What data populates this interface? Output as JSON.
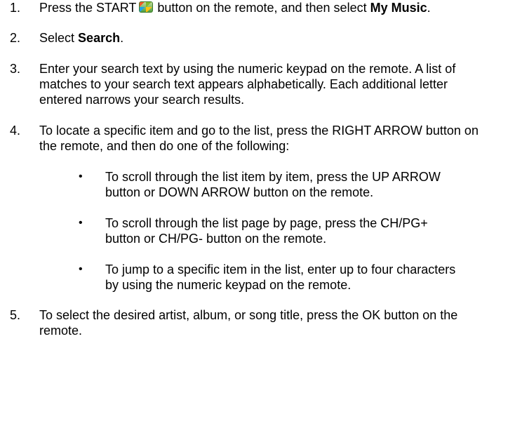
{
  "steps": [
    {
      "num": "1.",
      "text_a": "Press the START",
      "icon": "windows-start-icon",
      "text_b": "button on the remote, and then select",
      "bold": "My Music",
      "text_c": "."
    },
    {
      "num": "2.",
      "text_a": "Select",
      "bold": "Search",
      "text_c": "."
    },
    {
      "num": "3.",
      "text": "Enter your search text by using the numeric keypad on the remote. A list of matches to your search text appears alphabetically. Each additional letter entered narrows your search results."
    },
    {
      "num": "4.",
      "text": "To locate a specific item and go to the list, press the RIGHT ARROW button on the remote, and then do one of the following:",
      "bullets": [
        "To scroll through the list item by item, press the UP ARROW button or DOWN ARROW button on the remote.",
        "To scroll through the list page by page, press the CH/PG+ button or CH/PG- button on the remote.",
        "To jump to a specific item in the list, enter up to four characters by using the numeric keypad on the remote."
      ]
    },
    {
      "num": "5.",
      "text": "To select the desired artist, album, or song title, press the OK button on the remote."
    }
  ],
  "bullet_char": "•"
}
